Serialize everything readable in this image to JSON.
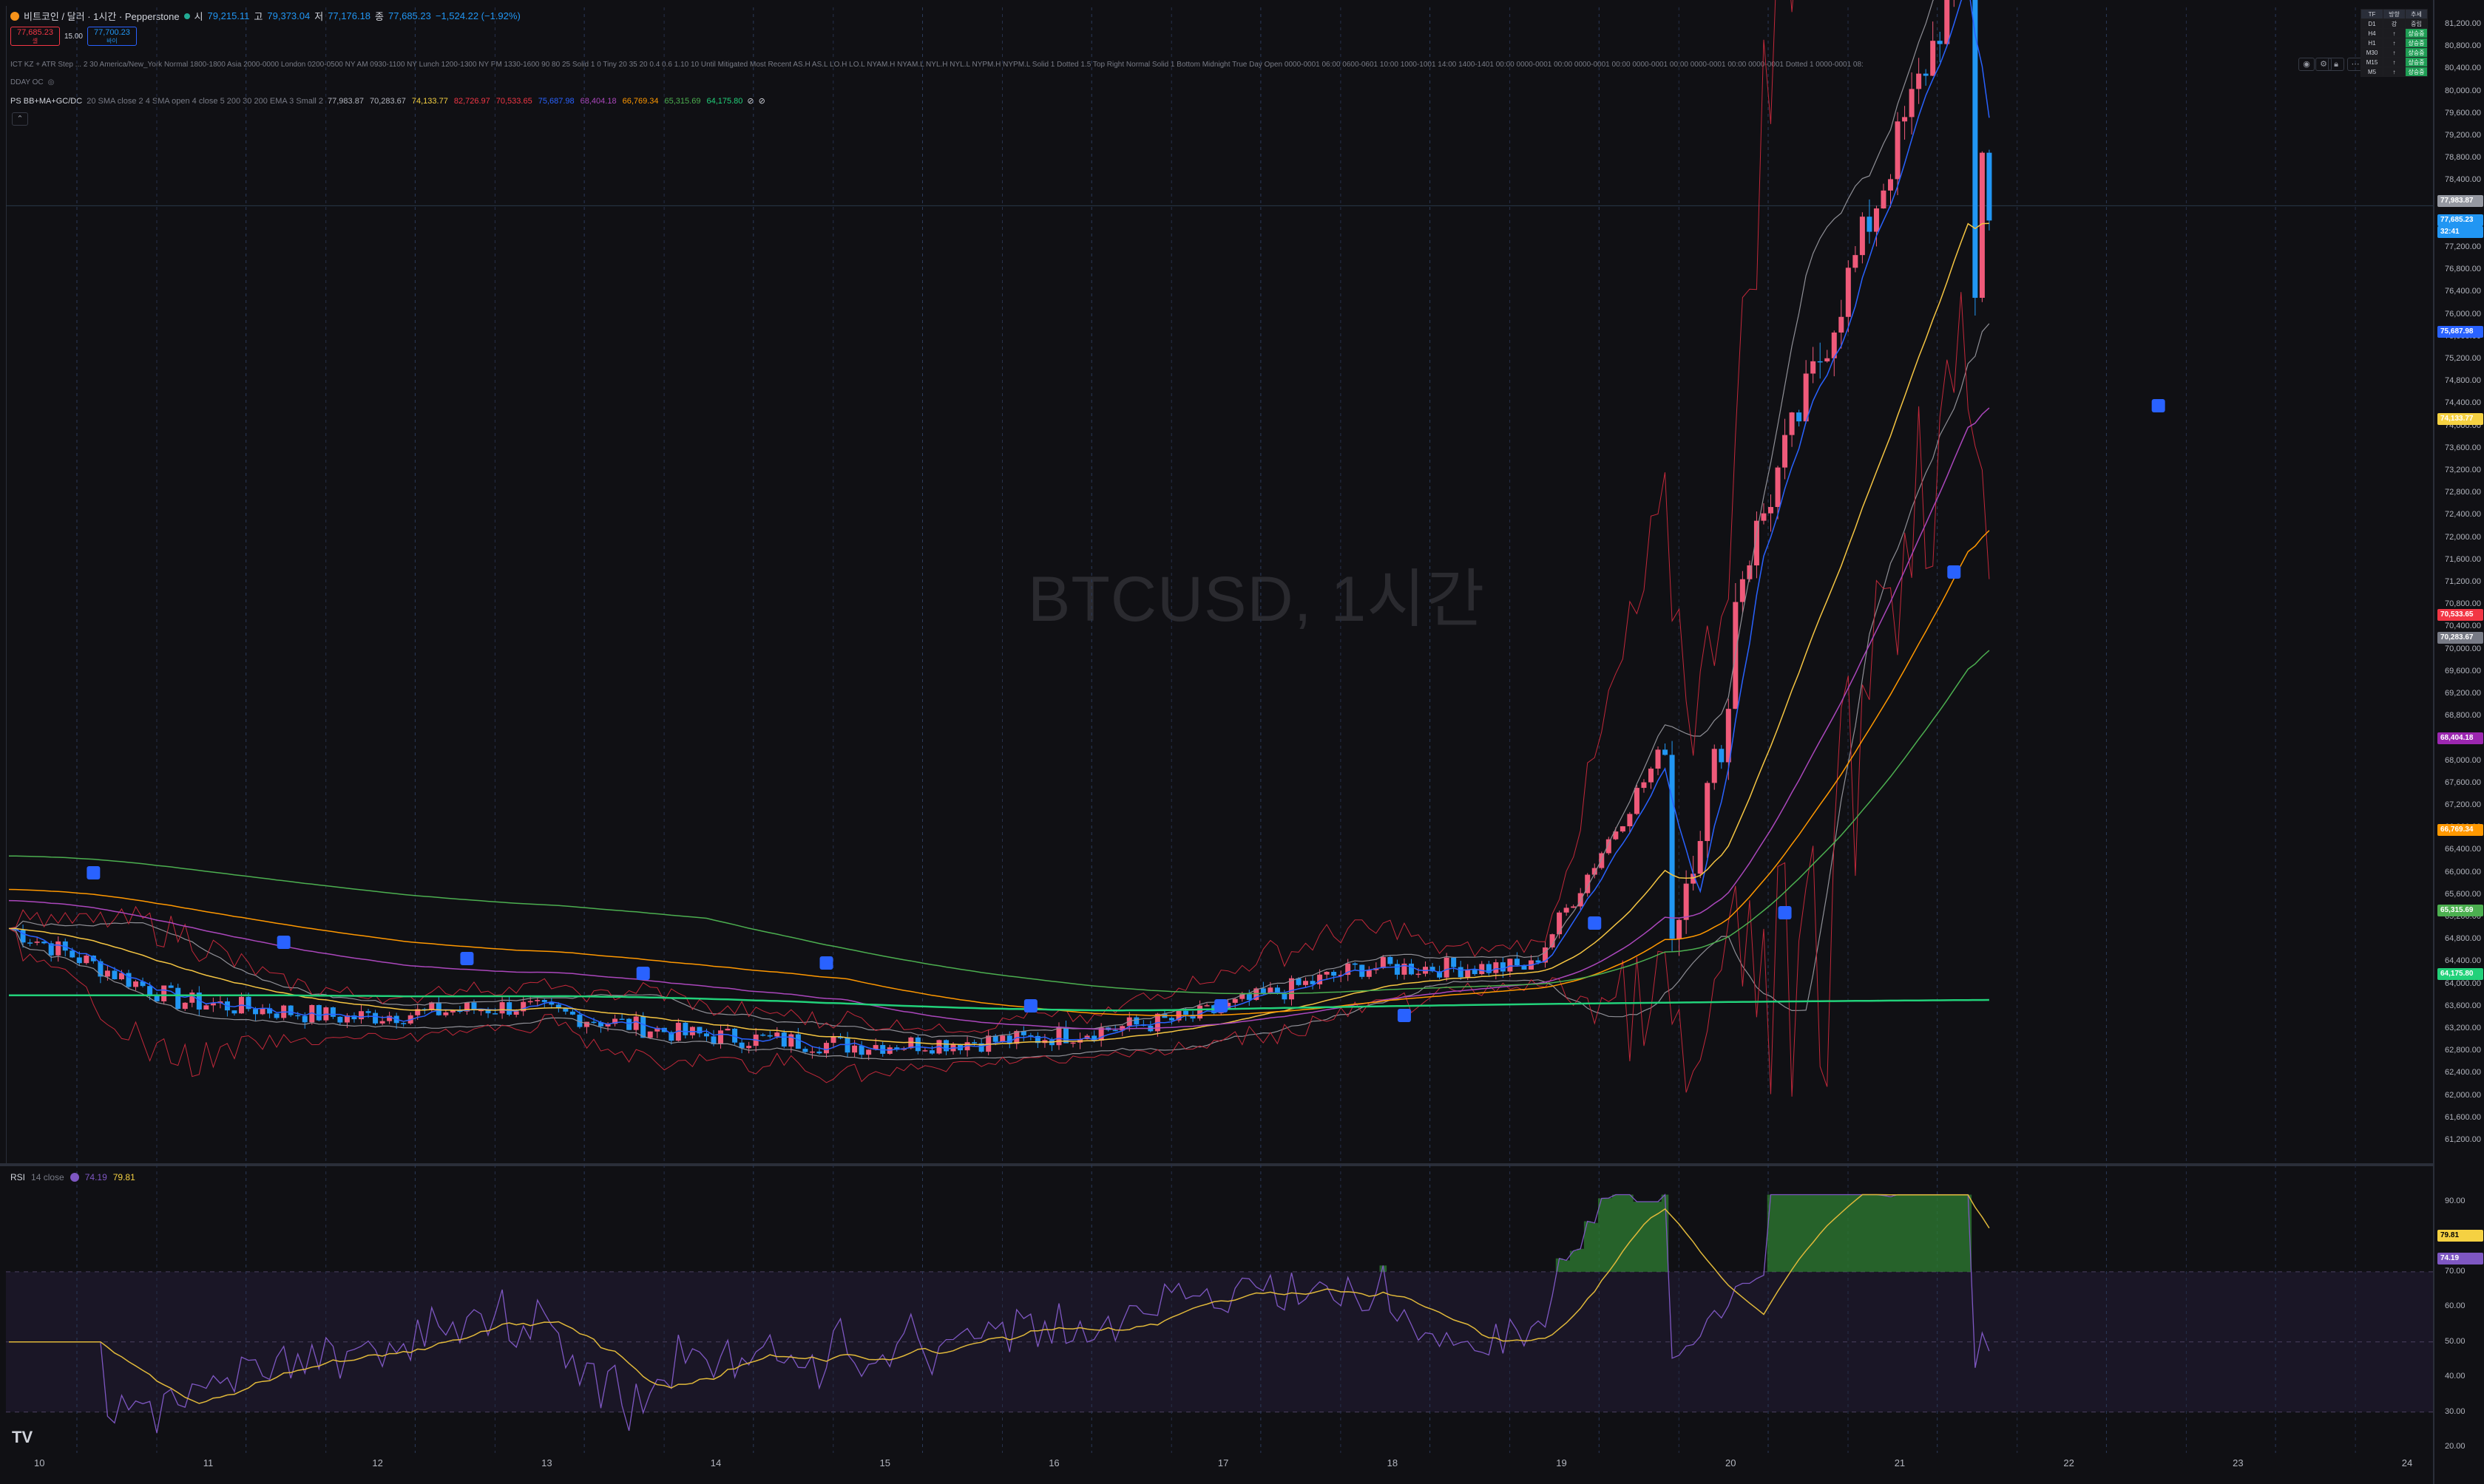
{
  "header": {
    "symbol_title": "비트코인 / 달러 · 1시간 · Pepperstone",
    "ohlc": {
      "open_label": "시",
      "open": "79,215.11",
      "high_label": "고",
      "high": "79,373.04",
      "low_label": "저",
      "low": "77,176.18",
      "close_label": "종",
      "close": "77,685.23",
      "change": "−1,524.22 (−1.92%)"
    },
    "sell_price": "77,685.23",
    "sell_label": "셀",
    "spread": "15.00",
    "buy_price": "77,700.23",
    "buy_label": "바이"
  },
  "indicators": {
    "ict_line": "ICT KZ + ATR Step ... 2 30 America/New_York Normal 1800-1800 Asia 2000-0000 London 0200-0500 NY AM 0930-1100 NY Lunch 1200-1300 NY PM 1330-1600 90 80 25 Solid 1 0 Tiny 20 35 20 0.4 0.6 1.10 10 Until Mitigated Most Recent AS.H AS.L LO.H LO.L NYAM.H NYAM.L NYL.H NYL.L NYPM.H NYPM.L Solid 1 Dotted 1.5 Top Right Normal Solid 1 Bottom Midnight True Day Open 0000-0001 06:00 0600-0601 10:00 1000-1001 14:00 1400-1401 00:00 0000-0001 00:00 0000-0001 00:00 0000-0001 00:00 0000-0001 00:00 0000-0001 Dotted 1 0000-0001 08:",
    "dday_label": "DDAY OC",
    "ps_label": "PS BB+MA+GC/DC",
    "ps_params": "20 SMA close 2 4 SMA open 4 close 5 200 30 200 EMA 3 Small 2",
    "ps_values": [
      {
        "value": "77,983.87",
        "color": "#b2b5be"
      },
      {
        "value": "70,283.67",
        "color": "#b2b5be"
      },
      {
        "value": "74,133.77",
        "color": "#f5d142"
      },
      {
        "value": "82,726.97",
        "color": "#f23645"
      },
      {
        "value": "70,533.65",
        "color": "#f23645"
      },
      {
        "value": "75,687.98",
        "color": "#2962ff"
      },
      {
        "value": "68,404.18",
        "color": "#ab47bc"
      },
      {
        "value": "66,769.34",
        "color": "#ff9800"
      },
      {
        "value": "65,315.69",
        "color": "#4caf50"
      },
      {
        "value": "64,175.80",
        "color": "#22d17a"
      }
    ]
  },
  "watermark": "BTCUSD, 1시간",
  "rsi": {
    "label": "RSI",
    "params": "14 close",
    "value": "74.19",
    "ma_value": "79.81",
    "axis": [
      "90.00",
      "80.00",
      "70.00",
      "60.00",
      "50.00",
      "40.00",
      "30.00",
      "20.00"
    ],
    "tag_ma": "79.81",
    "tag_rsi": "74.19"
  },
  "price_axis": [
    "81,200.00",
    "80,800.00",
    "80,400.00",
    "80,000.00",
    "79,600.00",
    "79,200.00",
    "78,800.00",
    "78,400.00",
    "78,000.00",
    "77,600.00",
    "77,200.00",
    "76,800.00",
    "76,400.00",
    "76,000.00",
    "75,600.00",
    "75,200.00",
    "74,800.00",
    "74,400.00",
    "74,000.00",
    "73,600.00",
    "73,200.00",
    "72,800.00",
    "72,400.00",
    "72,000.00",
    "71,600.00",
    "71,200.00",
    "70,800.00",
    "70,400.00",
    "70,000.00",
    "69,600.00",
    "69,200.00",
    "68,800.00",
    "68,400.00",
    "68,000.00",
    "67,600.00",
    "67,200.00",
    "66,800.00",
    "66,400.00",
    "66,000.00",
    "65,600.00",
    "65,200.00",
    "64,800.00",
    "64,400.00",
    "64,000.00",
    "63,600.00",
    "63,200.00",
    "62,800.00",
    "62,400.00",
    "62,000.00",
    "61,600.00",
    "61,200.00"
  ],
  "price_tags": [
    {
      "value": "77,983.87",
      "color": "#9598a1"
    },
    {
      "value": "77,685.23",
      "color": "#2196f3"
    },
    {
      "value": "75,687.98",
      "color": "#2962ff"
    },
    {
      "value": "74,133.77",
      "color": "#f5d142"
    },
    {
      "value": "70,533.65",
      "color": "#f23645"
    },
    {
      "value": "70,283.67",
      "color": "#787b86"
    },
    {
      "value": "68,404.18",
      "color": "#9c27b0"
    },
    {
      "value": "66,769.34",
      "color": "#ff9800"
    },
    {
      "value": "65,315.69",
      "color": "#4caf50"
    },
    {
      "value": "64,175.80",
      "color": "#22d17a"
    }
  ],
  "countdown": "32:41",
  "time_axis": [
    "10",
    "11",
    "12",
    "13",
    "14",
    "15",
    "16",
    "17",
    "18",
    "19",
    "20",
    "21",
    "22",
    "23",
    "24"
  ],
  "tf_table": {
    "header": [
      "TF",
      "방향",
      "추세"
    ],
    "rows": [
      [
        "D1",
        "강",
        "중립"
      ],
      [
        "H4",
        "↑",
        "상승중"
      ],
      [
        "H1",
        "↑",
        "상승중"
      ],
      [
        "M30",
        "↑",
        "상승중"
      ],
      [
        "M15",
        "↑",
        "상승중"
      ],
      [
        "M5",
        "↑",
        "상승중"
      ]
    ]
  },
  "chart_data": {
    "type": "candlestick",
    "symbol": "BTCUSD",
    "timeframe": "1시간",
    "ylim": [
      61000,
      81300
    ],
    "x": [
      "10",
      "11",
      "12",
      "13",
      "14",
      "15",
      "16",
      "17",
      "18",
      "19",
      "20",
      "21"
    ],
    "close_daily": [
      65000,
      63700,
      63400,
      63600,
      63100,
      62900,
      63000,
      63400,
      64300,
      64300,
      69300,
      77685
    ]
  }
}
